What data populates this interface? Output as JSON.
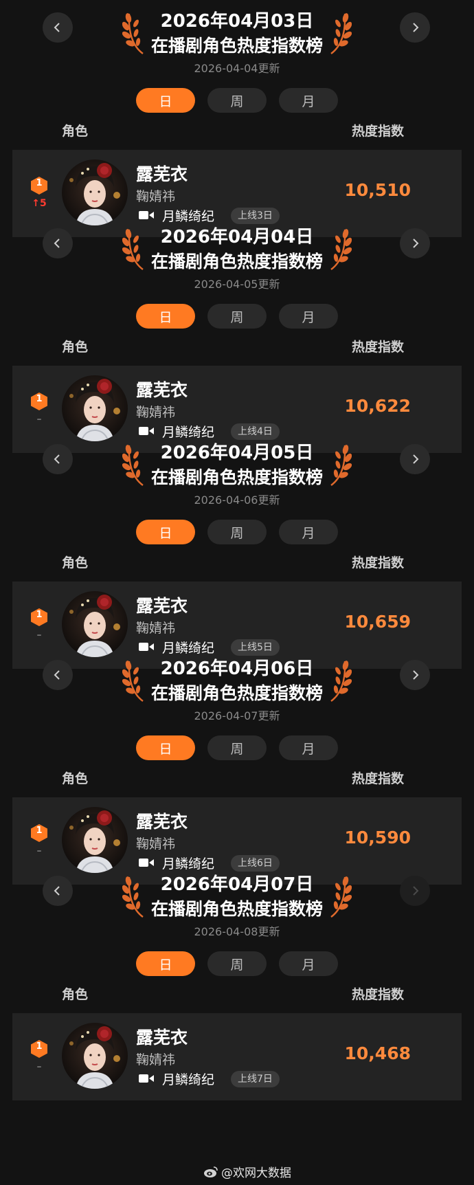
{
  "labels": {
    "col_role": "角色",
    "col_heat": "热度指数",
    "title": "在播剧角色热度指数榜"
  },
  "tabs": [
    "日",
    "周",
    "月"
  ],
  "sections": [
    {
      "date": "2026年04月03日",
      "updated": "2026-04-04更新",
      "rank": "1",
      "rank_change": "↑5",
      "character": "露芜衣",
      "actor": "鞠婧祎",
      "show": "月鳞绮纪",
      "online": "上线3日",
      "heat": "10,510"
    },
    {
      "date": "2026年04月04日",
      "updated": "2026-04-05更新",
      "rank": "1",
      "rank_change": "–",
      "character": "露芜衣",
      "actor": "鞠婧祎",
      "show": "月鳞绮纪",
      "online": "上线4日",
      "heat": "10,622"
    },
    {
      "date": "2026年04月05日",
      "updated": "2026-04-06更新",
      "rank": "1",
      "rank_change": "–",
      "character": "露芜衣",
      "actor": "鞠婧祎",
      "show": "月鳞绮纪",
      "online": "上线5日",
      "heat": "10,659"
    },
    {
      "date": "2026年04月06日",
      "updated": "2026-04-07更新",
      "rank": "1",
      "rank_change": "–",
      "character": "露芜衣",
      "actor": "鞠婧祎",
      "show": "月鳞绮纪",
      "online": "上线6日",
      "heat": "10,590"
    },
    {
      "date": "2026年04月07日",
      "updated": "2026-04-08更新",
      "rank": "1",
      "rank_change": "–",
      "character": "露芜衣",
      "actor": "鞠婧祎",
      "show": "月鳞绮纪",
      "online": "上线7日",
      "heat": "10,468"
    }
  ],
  "watermark": "@欢网大数据",
  "colors": {
    "accent": "#ff7a22",
    "heat": "#ff8a3d",
    "rank_up": "#ff3b30",
    "card": "#232323"
  },
  "icons": {
    "prev": "chevron-left-icon",
    "next": "chevron-right-icon",
    "laurel": "laurel-icon",
    "video": "video-camera-icon",
    "weibo": "weibo-icon"
  }
}
